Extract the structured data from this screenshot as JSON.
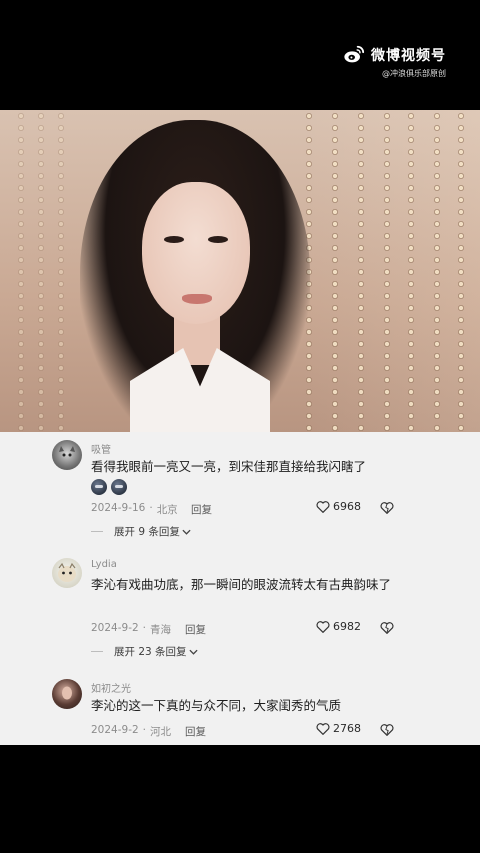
{
  "watermark": {
    "title": "微博视频号",
    "handle": "@冲浪俱乐部原创"
  },
  "comments": [
    {
      "user": "吸管",
      "text": "看得我眼前一亮又一亮，到宋佳那直接给我闪瞎了",
      "date": "2024-9-16",
      "location": "北京",
      "reply_label": "回复",
      "likes": "6968",
      "expand": "展开 9 条回复"
    },
    {
      "user": "Lydia",
      "text": "李沁有戏曲功底，那一瞬间的眼波流转太有古典韵味了",
      "date": "2024-9-2",
      "location": "青海",
      "reply_label": "回复",
      "likes": "6982",
      "expand": "展开 23 条回复"
    },
    {
      "user": "如初之光",
      "text": "李沁的这一下真的与众不同，大家闺秀的气质",
      "date": "2024-9-2",
      "location": "河北",
      "reply_label": "回复",
      "likes": "2768"
    }
  ],
  "colors": {
    "panel_bg": "#f1f1f1",
    "text": "#1d1d1d",
    "meta": "#8c8c8c"
  }
}
